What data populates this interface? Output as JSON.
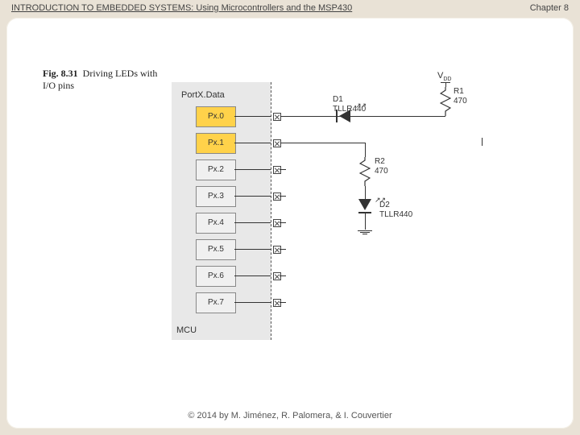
{
  "header": {
    "title": "INTRODUCTION TO EMBEDDED SYSTEMS: Using Microcontrollers and the MSP430",
    "chapter": "Chapter 8"
  },
  "footer": {
    "copyright": "© 2014 by M. Jiménez, R. Palomera, & I. Couvertier"
  },
  "figure": {
    "number": "Fig. 8.31",
    "caption": "Driving LEDs with I/O pins"
  },
  "diagram": {
    "mcu_label": "MCU",
    "port_label": "PortX.Data",
    "pins": [
      {
        "name": "Px.0",
        "active": true
      },
      {
        "name": "Px.1",
        "active": true
      },
      {
        "name": "Px.2",
        "active": false
      },
      {
        "name": "Px.3",
        "active": false
      },
      {
        "name": "Px.4",
        "active": false
      },
      {
        "name": "Px.5",
        "active": false
      },
      {
        "name": "Px.6",
        "active": false
      },
      {
        "name": "Px.7",
        "active": false
      }
    ],
    "vdd": "VDD",
    "components": {
      "D1": {
        "ref": "D1",
        "part": "TLLR440"
      },
      "D2": {
        "ref": "D2",
        "part": "TLLR440"
      },
      "R1": {
        "ref": "R1",
        "value": "470"
      },
      "R2": {
        "ref": "R2",
        "value": "470"
      }
    }
  }
}
